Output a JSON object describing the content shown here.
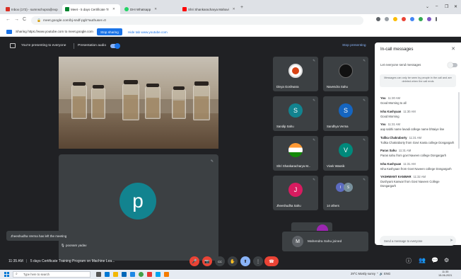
{
  "browser": {
    "tabs": [
      {
        "label": "Inbox (172) - sumnschopra@exp",
        "active": false,
        "color": "#d93025"
      },
      {
        "label": "Meet - 5 days Certificate Tr",
        "active": true,
        "color": "#00832d"
      },
      {
        "label": "DHI Whatsapp",
        "active": false,
        "color": "#25d366"
      },
      {
        "label": "Shri Shankaracharya Mahavi",
        "active": false,
        "color": "#ff0000"
      }
    ],
    "url": "meet.google.com/bj-sndf-pgb?authuser=0",
    "window_controls": [
      "⌄",
      "–",
      "❐",
      "✕"
    ]
  },
  "share_bar": {
    "text": "Sharing https://www.youtube.com to meet.google.com",
    "stop_button": "Stop sharing",
    "hide_button": "Hide tab www.youtube.com"
  },
  "presenting_bar": {
    "status": "You're presenting to everyone",
    "audio_label": "Presentation audio",
    "stop_label": "Stop presenting"
  },
  "participants": [
    {
      "name": "Divya Goshwara",
      "initial": "",
      "color": "#ffffff",
      "kind": "photo"
    },
    {
      "name": "Navendra Sahu",
      "initial": "",
      "color": "#111111",
      "kind": "logo"
    },
    {
      "name": "Sandip Sahu",
      "initial": "S",
      "color": "#12838f"
    },
    {
      "name": "Sandhya Verma",
      "initial": "S",
      "color": "#1565c0"
    },
    {
      "name": "Shri Shankaracharya M...",
      "initial": "",
      "color": "#ffffff",
      "kind": "flag"
    },
    {
      "name": "Vivek Wasnik",
      "initial": "V",
      "color": "#00897b"
    },
    {
      "name": "Jheeshudha Sahu",
      "initial": "J",
      "color": "#d81b60"
    },
    {
      "name": "14 others",
      "initial": "",
      "color": "#5c6bc0",
      "kind": "others"
    }
  ],
  "self": {
    "initial": "p",
    "label": "poonam yadav"
  },
  "toast": "Jheeshudha Verma has left the meeting",
  "joined": {
    "initial": "M",
    "text": "Mahendra Sahu joined"
  },
  "bottom": {
    "time": "11:35 AM",
    "separator": "|",
    "meeting": "5 days Certificate Training Program on Machine Lea...",
    "controls": [
      "🎤",
      "📷",
      "CC",
      "✋",
      "⬆",
      "⋮"
    ],
    "end_icon": "☎",
    "right_icons": [
      "ⓘ",
      "👥",
      "💬",
      "⚙"
    ]
  },
  "chat": {
    "title": "In-call messages",
    "allow_label": "Let everyone send messages",
    "notice": "Messages can only be seen by people in the call and are deleted when the call ends",
    "messages": [
      {
        "from": "You",
        "time": "11:30 AM",
        "text": "Good Morning to all"
      },
      {
        "from": "Isha Kashyaan",
        "time": "11:30 AM",
        "text": "Good Morning"
      },
      {
        "from": "You",
        "time": "11:31 AM",
        "text": "aap sabhi name lavadi college name bhtaiye line"
      },
      {
        "from": "Tulika Chakraborty",
        "time": "11:31 AM",
        "text": "Tulika Chakraborty from Govt Kanta college Dongargarh"
      },
      {
        "from": "Paras Sahu",
        "time": "11:31 AM",
        "text": "Paras sahu from govt Naveen college Dongargarh"
      },
      {
        "from": "Isha Kashyaan",
        "time": "11:31 AM",
        "text": "Isha Kashyaan from Govt Naveen college Dongargarh"
      },
      {
        "from": "YASHWANT KANWAR",
        "time": "11:32 AM",
        "text": "Dushyant Kanwar from Govt Naveen College Dongargarh"
      }
    ],
    "compose_placeholder": "Send a message to everyone",
    "send_icon": "➤"
  },
  "taskbar": {
    "search_placeholder": "Type here to search",
    "tray": "29°C  Mostly sunny  ⌃ 🔊 ENG",
    "time": "11:35",
    "date": "15-06-2021"
  }
}
